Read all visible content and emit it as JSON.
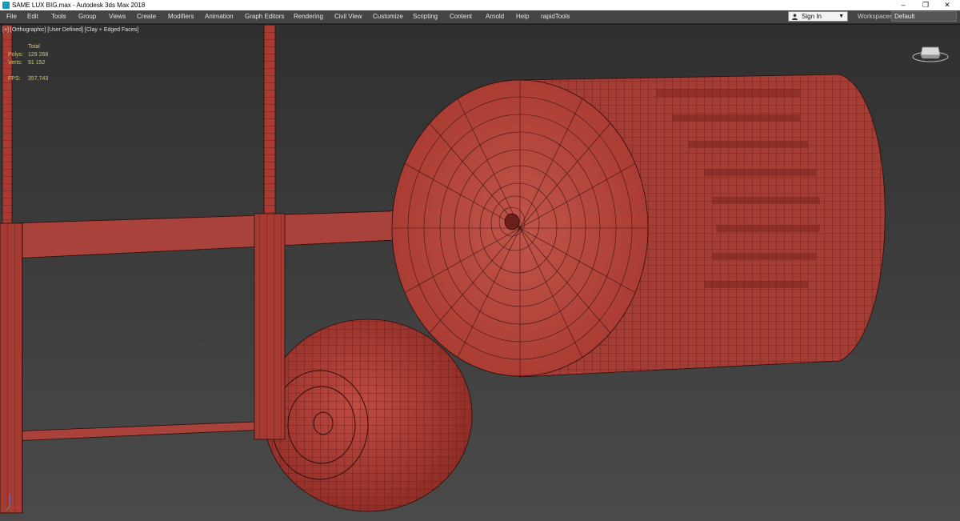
{
  "window": {
    "title": "SAME LUX BIG.max - Autodesk 3ds Max 2018",
    "controls": {
      "minimize": "–",
      "restore": "❐",
      "close": "✕"
    }
  },
  "menu": {
    "items": [
      "File",
      "Edit",
      "Tools",
      "Group",
      "Views",
      "Create",
      "Modifiers",
      "Animation",
      "Graph Editors",
      "Rendering",
      "Civil View",
      "Customize",
      "Scripting",
      "Content",
      "Arnold",
      "Help",
      "rapidTools"
    ]
  },
  "account": {
    "signin_label": "Sign In",
    "icon": "user-icon"
  },
  "workspaces": {
    "label": "Workspaces:",
    "value": "Default"
  },
  "viewport": {
    "label": "[+] [Orthographic] [User Defined] [Clay + Edged Faces]",
    "stats": {
      "header": "Total",
      "polys_label": "Polys:",
      "polys_value": "129 268",
      "verts_label": "Verts:",
      "verts_value": "91 152",
      "fps_label": "FPS:",
      "fps_value": "357,743"
    },
    "clay_color": "#b5433a"
  }
}
